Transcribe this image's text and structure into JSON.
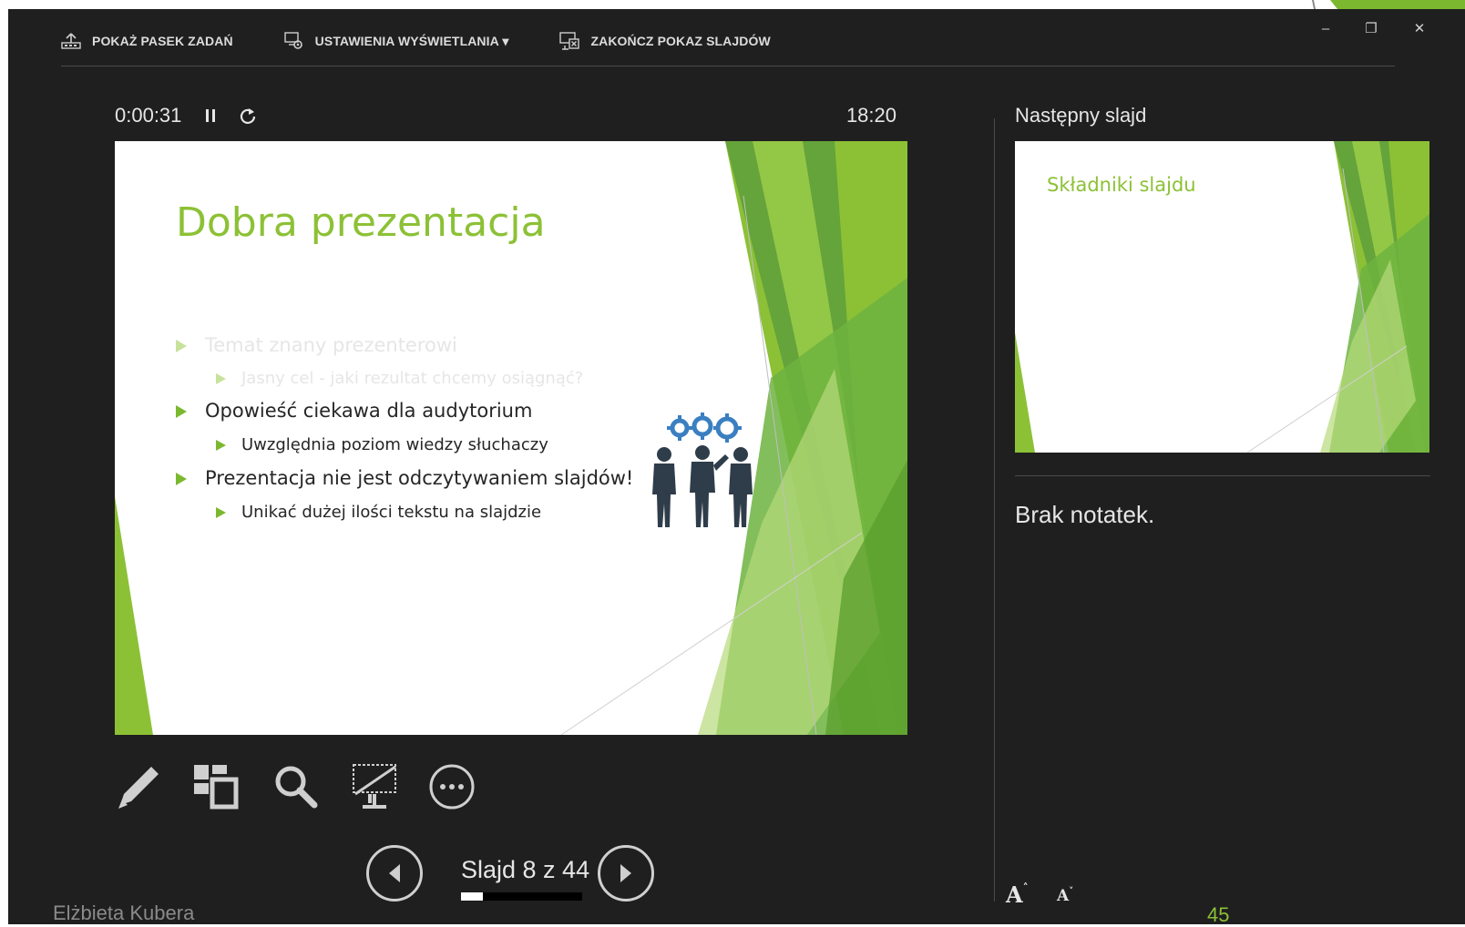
{
  "toolbar": {
    "show_taskbar": "POKAŻ PASEK ZADAŃ",
    "display_settings": "USTAWIENIA WYŚWIETLANIA ▾",
    "end_show": "ZAKOŃCZ POKAZ SLAJDÓW"
  },
  "window_controls": {
    "minimize": "–",
    "restore": "❐",
    "close": "✕"
  },
  "timer": {
    "elapsed": "0:00:31",
    "clock": "18:20"
  },
  "current_slide": {
    "title": "Dobra prezentacja",
    "bullets": [
      {
        "text": "Temat znany prezenterowi",
        "level": 1,
        "faded": true
      },
      {
        "text": "Jasny cel - jaki rezultat chcemy osiągnąć?",
        "level": 2,
        "faded": true
      },
      {
        "text": "Opowieść ciekawa dla audytorium",
        "level": 1,
        "faded": false
      },
      {
        "text": "Uwzględnia poziom wiedzy słuchaczy",
        "level": 2,
        "faded": false
      },
      {
        "text": "Prezentacja nie jest odczytywaniem slajdów!",
        "level": 1,
        "faded": false
      },
      {
        "text": "Unikać dużej ilości tekstu na slajdzie",
        "level": 2,
        "faded": false
      }
    ],
    "graphic_icon": "team-gears-icon"
  },
  "tools": [
    "pen-icon",
    "slide-sorter-icon",
    "zoom-icon",
    "black-screen-icon",
    "more-options-icon"
  ],
  "navigation": {
    "slide_counter": "Slajd 8 z 44",
    "progress": 0.18
  },
  "next_slide": {
    "label": "Następny slajd",
    "title": "Składniki slajdu"
  },
  "notes": {
    "text": "Brak notatek."
  },
  "font_controls": {
    "increase": "A",
    "decrease": "A"
  },
  "footer": {
    "author": "Elżbieta Kubera",
    "page_number": "45"
  },
  "colors": {
    "accent_green": "#8cc136",
    "background": "#1f1f1f",
    "icon_blue": "#3a7fc1",
    "figure_gray": "#2f3d4a"
  }
}
